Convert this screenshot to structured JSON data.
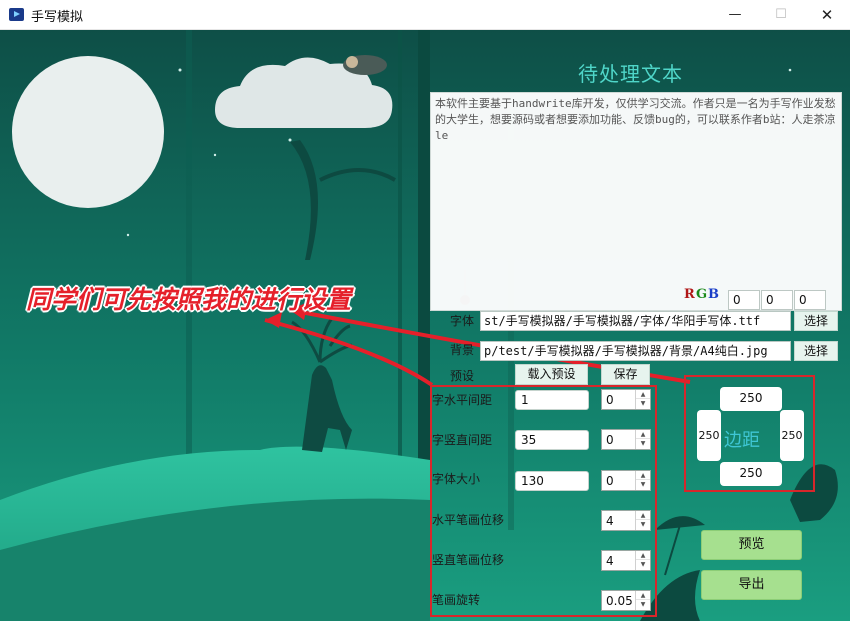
{
  "window": {
    "title": "手写模拟",
    "minimize": "—",
    "maximize": "☐",
    "close": "✕"
  },
  "text_panel": {
    "title": "待处理文本",
    "content": "本软件主要基于handwrite库开发，仅供学习交流。作者只是一名为手写作业发愁的大学生，想要源码或者想要添加功能、反馈bug的，可以联系作者b站：人走茶凉le"
  },
  "annotation": "同学们可先按照我的进行设置",
  "rgb": {
    "r_label": "R",
    "g_label": "G",
    "b_label": "B",
    "r": "0",
    "g": "0",
    "b": "0",
    "colors": {
      "r": "#b01818",
      "g": "#1a8a1a",
      "b": "#1a3ec8"
    }
  },
  "font": {
    "label": "字体",
    "path": "st/手写模拟器/手写模拟器/字体/华阳手写体.ttf",
    "choose": "选择"
  },
  "background": {
    "label": "背景",
    "path": "p/test/手写模拟器/手写模拟器/背景/A4纯白.jpg",
    "choose": "选择"
  },
  "preset": {
    "label": "预设",
    "load": "载入预设",
    "save": "保存"
  },
  "settings": [
    {
      "label": "字水平间距",
      "value": "1",
      "spin": "0"
    },
    {
      "label": "字竖直间距",
      "value": "35",
      "spin": "0"
    },
    {
      "label": "字体大小",
      "value": "130",
      "spin": "0"
    }
  ],
  "strokes": [
    {
      "label": "水平笔画位移",
      "value": "4"
    },
    {
      "label": "竖直笔画位移",
      "value": "4"
    },
    {
      "label": "笔画旋转",
      "value": "0.05"
    }
  ],
  "margins": {
    "label": "边距",
    "top": "250",
    "left": "250",
    "right": "250",
    "bottom": "250"
  },
  "actions": {
    "preview": "预览",
    "export": "导出"
  },
  "colors": {
    "scene": "#0f5a4f",
    "accent_red": "#d8262b",
    "green_button": "#a6e08f",
    "title_cyan": "#4fd6c9"
  }
}
